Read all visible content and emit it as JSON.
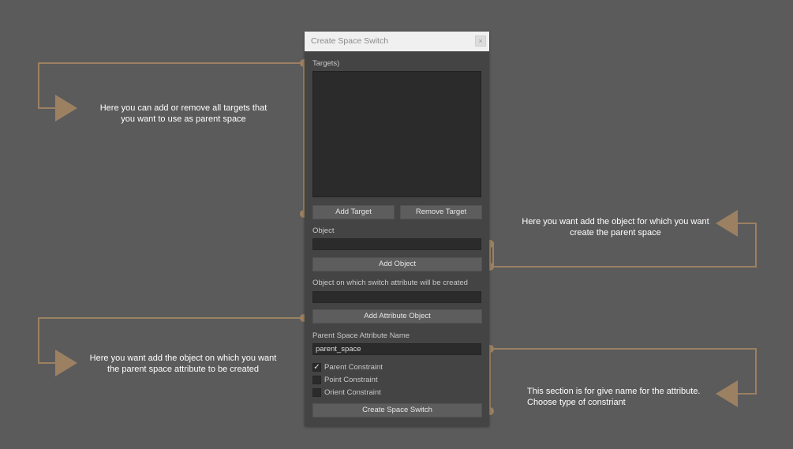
{
  "dialog": {
    "title": "Create Space Switch",
    "close_glyph": "×",
    "targets_label": "Targets)",
    "add_target_label": "Add Target",
    "remove_target_label": "Remove Target",
    "object_label": "Object",
    "object_value": "",
    "add_object_label": "Add Object",
    "switch_object_label": "Object on which switch attribute will be created",
    "switch_object_value": "",
    "add_attribute_object_label": "Add Attribute Object",
    "attr_name_label": "Parent Space Attribute Name",
    "attr_name_value": "parent_space",
    "constraints": [
      {
        "label": "Parent Constraint",
        "checked": true
      },
      {
        "label": "Point Constraint",
        "checked": false
      },
      {
        "label": "Orient Constraint",
        "checked": false
      }
    ],
    "create_label": "Create Space Switch"
  },
  "annotations": {
    "targets_note": {
      "line1": "Here you can add or remove all targets that",
      "line2": "you want to use as  parent space"
    },
    "object_note": {
      "line1": "Here you want add the object for which you want",
      "line2": "create the parent space"
    },
    "attribute_object_note": {
      "line1": "Here you want add the object on which you want",
      "line2": "the parent space attribute to be created"
    },
    "section_note": {
      "line1": "This section is for give name for the attribute.",
      "line2": "Choose type of constriant"
    }
  },
  "colors": {
    "background": "#5b5b5b",
    "annotation_line": "#9b8162",
    "dialog_bg": "#444444",
    "field_bg": "#2b2b2b",
    "button_bg": "#5d5d5d"
  },
  "icons": {
    "arrow": "triangle-arrow",
    "connector_dot": "circle-dot",
    "close": "close-icon",
    "check": "checkmark-icon"
  }
}
